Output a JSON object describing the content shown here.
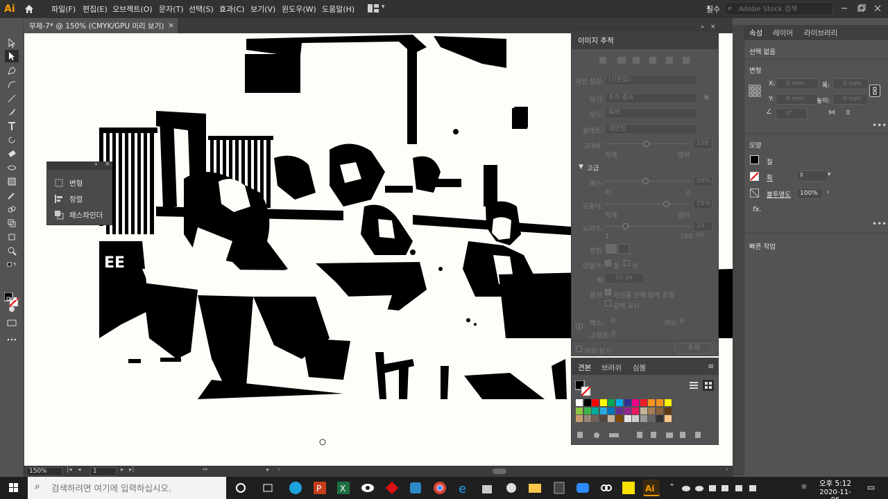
{
  "app": {
    "logo": "Ai",
    "workspace_label": "필수",
    "stock_placeholder": "Adobe Stock 검색"
  },
  "menu": [
    "파일(F)",
    "편집(E)",
    "오브젝트(O)",
    "문자(T)",
    "선택(S)",
    "효과(C)",
    "보기(V)",
    "윈도우(W)",
    "도움말(H)"
  ],
  "document_tab": {
    "label": "무제-7* @ 150% (CMYK/GPU 미리 보기)",
    "close": "×"
  },
  "mini_panel": {
    "items": [
      "변형",
      "정렬",
      "패스파인더"
    ]
  },
  "image_trace": {
    "title": "이미지 추적",
    "preset_label": "사전 설정:",
    "preset_value": "(기본값)",
    "view_label": "보기:",
    "view_value": "추적 결과",
    "mode_label": "모드:",
    "mode_value": "흑백",
    "palette_label": "팔레트:",
    "palette_value": "제한됨",
    "threshold_label": "고대비",
    "threshold_value": "128",
    "threshold_min": "적게",
    "threshold_max": "많이",
    "advanced_label": "고급",
    "paths_label": "패스:",
    "paths_value": "50%",
    "paths_min": "저",
    "paths_max": "고",
    "corners_label": "모퉁이:",
    "corners_value": "75%",
    "corners_min": "적게",
    "corners_max": "많이",
    "noise_label": "노이즈:",
    "noise_value": "25 px",
    "noise_min": "1",
    "noise_max": "100",
    "method_label": "방법:",
    "create_label": "만들기:",
    "fill_label": "칠",
    "stroke_label": "선",
    "stroke_width_label": "획:",
    "stroke_width_value": "10 px",
    "options_label": "옵션:",
    "snap_curves": "곡선을 선에 맞게 조정",
    "ignore_white": "공백 무시",
    "paths_stat": "패스:",
    "paths_stat_value": "0",
    "colors_stat": "색상:",
    "colors_stat_value": "0",
    "anchors_stat": "고정점:",
    "anchors_stat_value": "0",
    "preview_label": "미리 보기",
    "trace_button": "추적"
  },
  "swatches": {
    "tabs": [
      "견본",
      "브러쉬",
      "심볼"
    ],
    "colors": [
      "#ffffff",
      "#000000",
      "#ff0000",
      "#ffff00",
      "#00a651",
      "#00aeef",
      "#2e3192",
      "#ec008c",
      "#ed1c24",
      "#f7941d",
      "#f7941d",
      "#fff200",
      "#8dc63f",
      "#39b54a",
      "#00a99d",
      "#27aae1",
      "#0072bc",
      "#662d91",
      "#92278f",
      "#ed145b",
      "#c2b59b",
      "#a67c52",
      "#8c6239",
      "#603913",
      "#c69c6d",
      "#998675",
      "#736357",
      "#534741",
      "#c7b299",
      "#7d4900",
      "#e6e6e6",
      "#cccccc",
      "#999999",
      "#666666",
      "#333333",
      "#fdc689"
    ]
  },
  "properties": {
    "tabs": [
      "속성",
      "레이어",
      "라이브러리"
    ],
    "selection": "선택 없음",
    "transform_title": "변형",
    "x_label": "X:",
    "x_value": "0 mm",
    "y_label": "Y:",
    "y_value": "0 mm",
    "w_label": "폭:",
    "w_value": "0 mm",
    "h_label": "높이:",
    "h_value": "0 mm",
    "angle_value": "0°",
    "appearance_title": "모양",
    "fill_label": "칠",
    "stroke_label": "획",
    "opacity_label": "불투명도",
    "opacity_value": "100%",
    "fx_label": "fx.",
    "quick_actions": "빠른 작업"
  },
  "status": {
    "zoom": "150%",
    "page": "1"
  },
  "taskbar": {
    "search_placeholder": "검색하려면 여기에 입력하십시오.",
    "time": "오후 5:12",
    "date": "2020-11-06"
  }
}
